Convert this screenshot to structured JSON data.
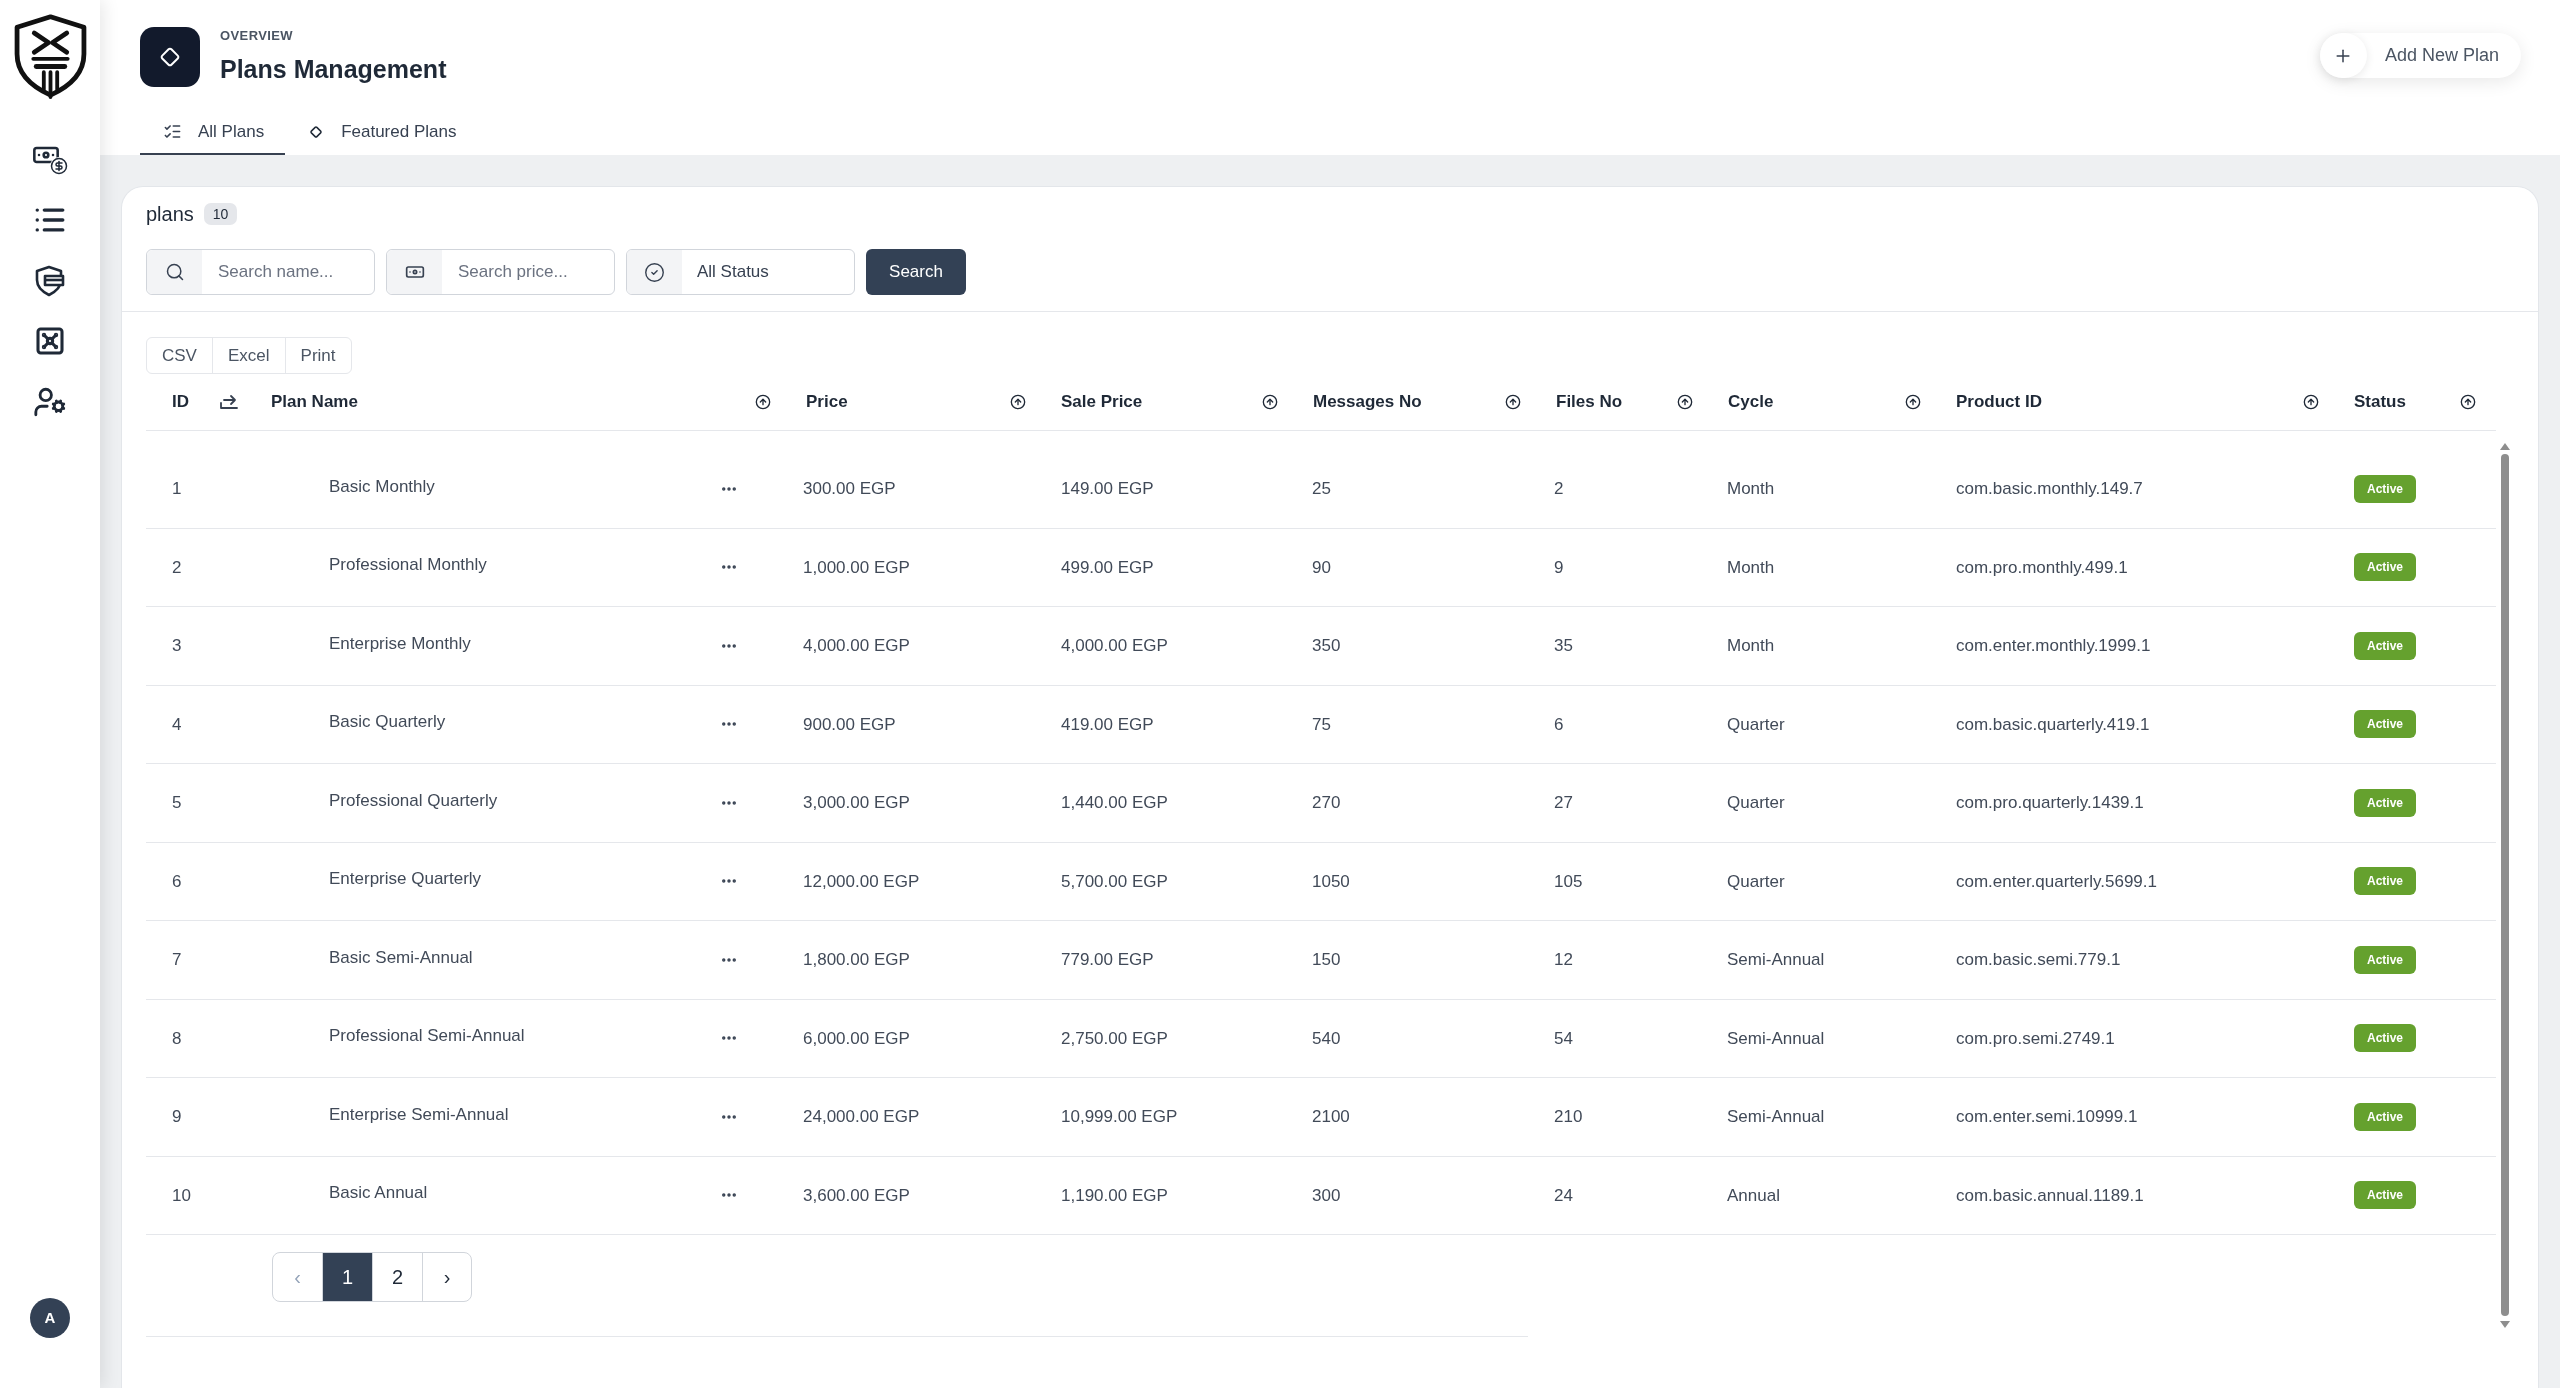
{
  "user": {
    "initial": "A"
  },
  "header": {
    "eyebrow": "OVERVIEW",
    "title": "Plans Management",
    "action": "Add New Plan"
  },
  "tabs": [
    {
      "label": "All Plans",
      "selected": true
    },
    {
      "label": "Featured Plans",
      "selected": false
    }
  ],
  "card": {
    "title": "plans",
    "count": "10"
  },
  "filters": {
    "name": {
      "placeholder": "Search name..."
    },
    "price": {
      "placeholder": "Search price..."
    },
    "status": {
      "value": "All Status"
    },
    "submit": "Search"
  },
  "export_buttons": [
    "CSV",
    "Excel",
    "Print"
  ],
  "table": {
    "columns": [
      {
        "label": "ID",
        "kind": "plain"
      },
      {
        "kind": "icon"
      },
      {
        "label": "Plan Name",
        "kind": "sortable"
      },
      {
        "label": "Price",
        "kind": "sortable"
      },
      {
        "label": "Sale Price",
        "kind": "sortable"
      },
      {
        "label": "Messages No",
        "kind": "sortable"
      },
      {
        "label": "Files No",
        "kind": "sortable"
      },
      {
        "label": "Cycle",
        "kind": "sortable"
      },
      {
        "label": "Product ID",
        "kind": "sortable"
      },
      {
        "label": "Status",
        "kind": "sortable"
      }
    ],
    "rows": [
      {
        "id": "1",
        "name": "Basic Monthly",
        "price": "300.00 EGP",
        "sale_price": "149.00 EGP",
        "messages": "25",
        "files": "2",
        "cycle": "Month",
        "product_id": "com.basic.monthly.149.7",
        "status": "Active"
      },
      {
        "id": "2",
        "name": "Professional Monthly",
        "price": "1,000.00 EGP",
        "sale_price": "499.00 EGP",
        "messages": "90",
        "files": "9",
        "cycle": "Month",
        "product_id": "com.pro.monthly.499.1",
        "status": "Active"
      },
      {
        "id": "3",
        "name": "Enterprise Monthly",
        "price": "4,000.00 EGP",
        "sale_price": "4,000.00 EGP",
        "messages": "350",
        "files": "35",
        "cycle": "Month",
        "product_id": "com.enter.monthly.1999.1",
        "status": "Active"
      },
      {
        "id": "4",
        "name": "Basic Quarterly",
        "price": "900.00 EGP",
        "sale_price": "419.00 EGP",
        "messages": "75",
        "files": "6",
        "cycle": "Quarter",
        "product_id": "com.basic.quarterly.419.1",
        "status": "Active"
      },
      {
        "id": "5",
        "name": "Professional Quarterly",
        "price": "3,000.00 EGP",
        "sale_price": "1,440.00 EGP",
        "messages": "270",
        "files": "27",
        "cycle": "Quarter",
        "product_id": "com.pro.quarterly.1439.1",
        "status": "Active"
      },
      {
        "id": "6",
        "name": "Enterprise Quarterly",
        "price": "12,000.00 EGP",
        "sale_price": "5,700.00 EGP",
        "messages": "1050",
        "files": "105",
        "cycle": "Quarter",
        "product_id": "com.enter.quarterly.5699.1",
        "status": "Active"
      },
      {
        "id": "7",
        "name": "Basic Semi-Annual",
        "price": "1,800.00 EGP",
        "sale_price": "779.00 EGP",
        "messages": "150",
        "files": "12",
        "cycle": "Semi-Annual",
        "product_id": "com.basic.semi.779.1",
        "status": "Active"
      },
      {
        "id": "8",
        "name": "Professional Semi-Annual",
        "price": "6,000.00 EGP",
        "sale_price": "2,750.00 EGP",
        "messages": "540",
        "files": "54",
        "cycle": "Semi-Annual",
        "product_id": "com.pro.semi.2749.1",
        "status": "Active"
      },
      {
        "id": "9",
        "name": "Enterprise Semi-Annual",
        "price": "24,000.00 EGP",
        "sale_price": "10,999.00 EGP",
        "messages": "2100",
        "files": "210",
        "cycle": "Semi-Annual",
        "product_id": "com.enter.semi.10999.1",
        "status": "Active"
      },
      {
        "id": "10",
        "name": "Basic Annual",
        "price": "3,600.00 EGP",
        "sale_price": "1,190.00 EGP",
        "messages": "300",
        "files": "24",
        "cycle": "Annual",
        "product_id": "com.basic.annual.1189.1",
        "status": "Active"
      }
    ]
  },
  "pagination": {
    "prev": {
      "label": "‹",
      "disabled": true
    },
    "pages": [
      {
        "label": "1",
        "selected": true
      },
      {
        "label": "2",
        "selected": false
      }
    ],
    "next": {
      "label": "›",
      "disabled": false
    }
  }
}
